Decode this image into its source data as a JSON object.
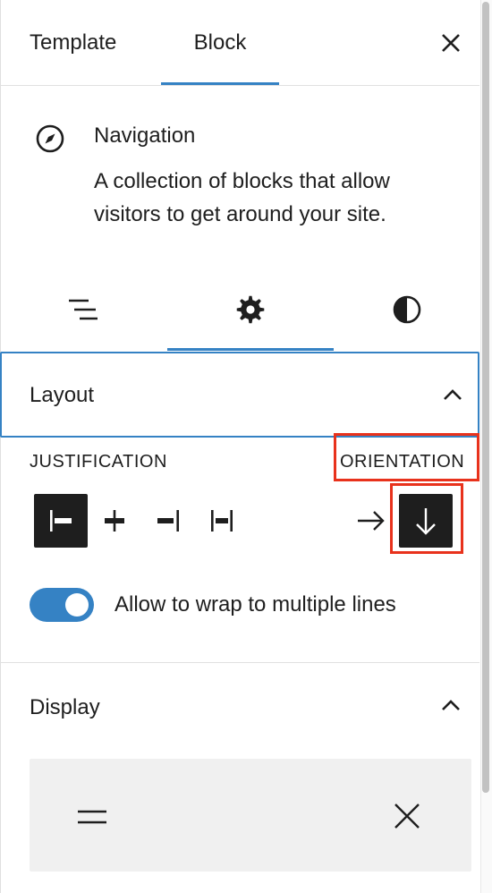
{
  "header": {
    "tabs": [
      "Template",
      "Block"
    ],
    "active_tab": "Block",
    "close_icon": "close-icon"
  },
  "block": {
    "icon": "compass-icon",
    "title": "Navigation",
    "description": "A collection of blocks that allow visitors to get around your site."
  },
  "subtabs": {
    "icons": [
      "list-view-icon",
      "gear-icon",
      "half-circle-contrast-icon"
    ],
    "active": "settings"
  },
  "layout": {
    "title": "Layout",
    "justification_label": "JUSTIFICATION",
    "orientation_label": "ORIENTATION",
    "justification_options": [
      "left",
      "center",
      "right",
      "space-between"
    ],
    "justification_selected": "left",
    "orientation_options": [
      "horizontal",
      "vertical"
    ],
    "orientation_selected": "vertical",
    "wrap_toggle_label": "Allow to wrap to multiple lines",
    "wrap_enabled": true
  },
  "display": {
    "title": "Display",
    "preview_icons": [
      "hamburger-menu-icon",
      "close-icon"
    ]
  },
  "colors": {
    "accent": "#3582c4",
    "highlight": "#e8321c",
    "dark": "#1e1e1e"
  }
}
